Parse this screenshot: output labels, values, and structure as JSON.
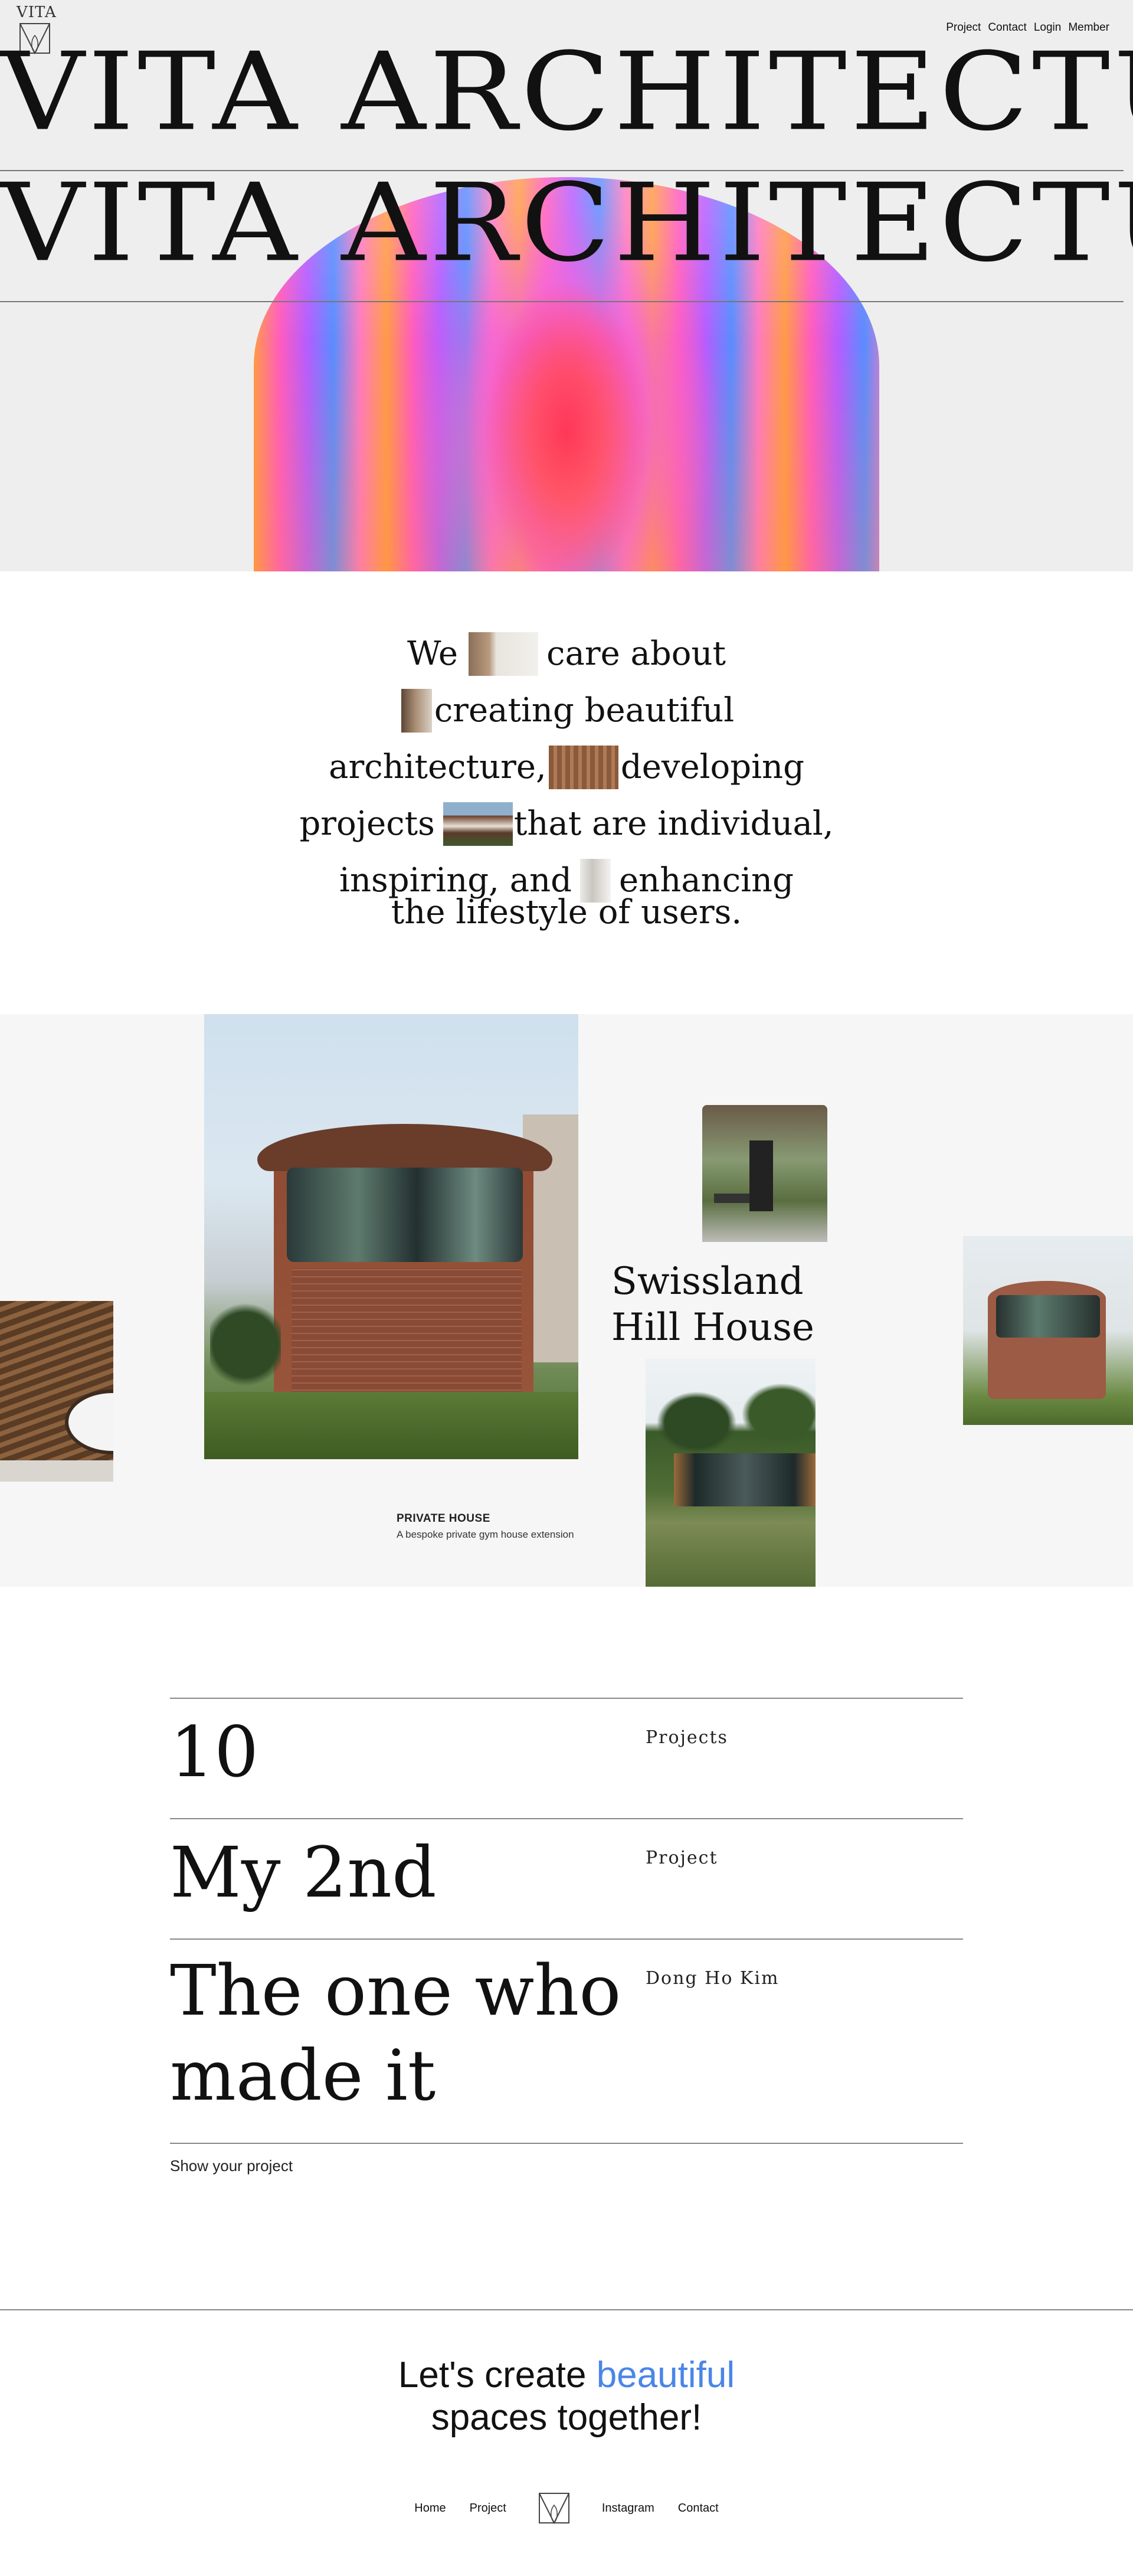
{
  "brand": {
    "logo_text": "VITA",
    "logo_icon": "vita-mark-icon"
  },
  "nav": {
    "items": [
      {
        "label": "Project"
      },
      {
        "label": "Contact"
      },
      {
        "label": "Login"
      },
      {
        "label": "Member"
      }
    ]
  },
  "hero": {
    "line_1": "VITA  ARCHITECTU",
    "line_2": "VITA  ARCHITECTU",
    "accent_colors": [
      "#ff4a6e",
      "#f460d8",
      "#5a8cff",
      "#ff9a48"
    ]
  },
  "intro": {
    "rows": [
      [
        "We",
        "care about"
      ],
      [
        "",
        "creating beautiful"
      ],
      [
        "architecture,",
        "developing"
      ],
      [
        "projects",
        "that are individual,"
      ],
      [
        "inspiring, and",
        "enhancing"
      ]
    ],
    "last_row": "the lifestyle of users."
  },
  "project": {
    "title_line_1": "Swissland",
    "title_line_2": "Hill House",
    "caption_title": "PRIVATE HOUSE",
    "caption_text": "A bespoke private gym house extension"
  },
  "stats": {
    "rows": [
      {
        "big": "10",
        "small": "Projects"
      },
      {
        "big": "My 2nd",
        "small": "Project"
      },
      {
        "big_1": "The one who",
        "big_2": "made it",
        "small": "Dong Ho Kim"
      }
    ],
    "link": "Show your project"
  },
  "cta": {
    "part_1": "Let's create ",
    "accent": "beautiful",
    "part_2": "spaces together!",
    "accent_color": "#4a86e8"
  },
  "footer": {
    "items": [
      {
        "label": "Home"
      },
      {
        "label": "Project"
      },
      {
        "label": "Instagram"
      },
      {
        "label": "Contact"
      }
    ]
  }
}
